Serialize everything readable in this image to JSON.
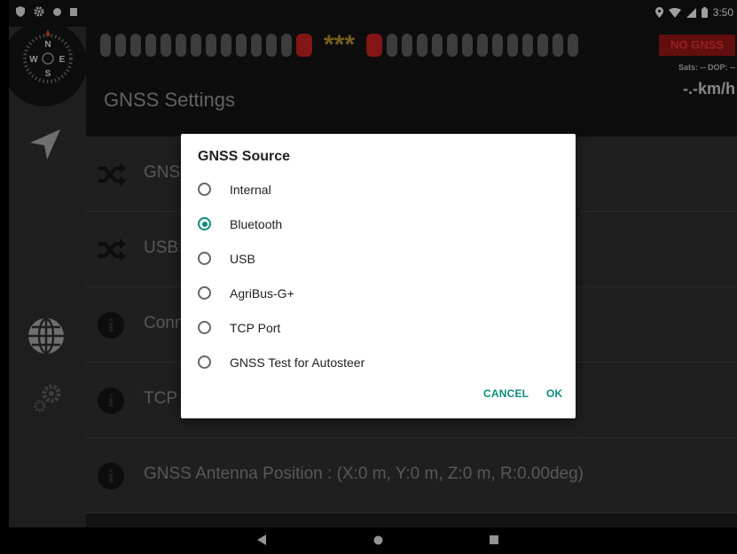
{
  "status_bar": {
    "time": "3:50"
  },
  "header": {
    "stars": "***",
    "gnss_status": "NO GNSS",
    "sats_dop": "Sats: -- DOP: --",
    "speed": "-.-km/h",
    "title": "GNSS Settings"
  },
  "rail": {
    "compass_labels": {
      "n": "N",
      "s": "S",
      "w": "W",
      "e": "E"
    }
  },
  "rows": [
    {
      "icon": "shuffle-icon",
      "text": "GNSS"
    },
    {
      "icon": "shuffle-icon",
      "text": "USB"
    },
    {
      "icon": "info-icon",
      "text": "Conn"
    },
    {
      "icon": "info-icon",
      "text": "TCP"
    },
    {
      "icon": "info-icon",
      "text": "GNSS Antenna Position : (X:0 m, Y:0 m, Z:0 m, R:0.00deg)"
    }
  ],
  "dialog": {
    "title": "GNSS Source",
    "options": [
      {
        "label": "Internal",
        "selected": false
      },
      {
        "label": "Bluetooth",
        "selected": true
      },
      {
        "label": "USB",
        "selected": false
      },
      {
        "label": "AgriBus-G+",
        "selected": false
      },
      {
        "label": "TCP Port",
        "selected": false
      },
      {
        "label": "GNSS Test for Autosteer",
        "selected": false
      }
    ],
    "cancel_label": "CANCEL",
    "ok_label": "OK"
  },
  "colors": {
    "accent": "#0c8c7a",
    "alert_red": "#b81e1e"
  }
}
